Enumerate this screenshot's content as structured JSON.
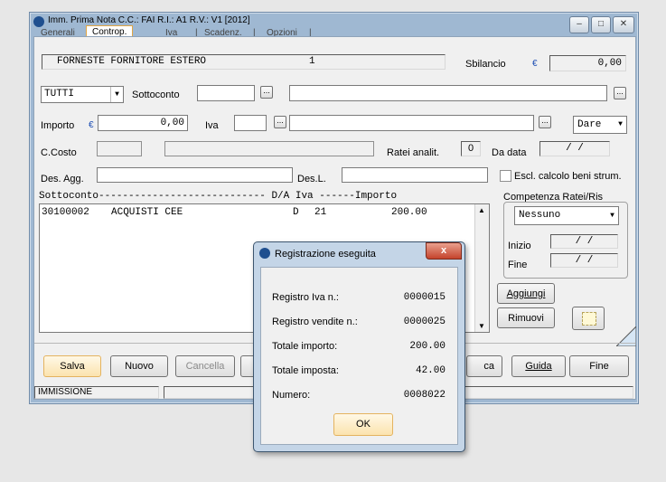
{
  "window": {
    "title": "Imm. Prima Nota C.C.: FAI  R.I.: A1  R.V.: V1  [2012]",
    "tabs": [
      "Generali",
      "Controp.",
      "Iva",
      "Scadenz.",
      "Opzioni"
    ],
    "active_tab": "Controp."
  },
  "header": {
    "supplier": "FORNESTE FORNITORE ESTERO",
    "number": "1",
    "sbilancio_label": "Sbilancio",
    "sbilancio_value": "0,00"
  },
  "form": {
    "filter_select": "TUTTI",
    "sottoconto_label": "Sottoconto",
    "importo_label": "Importo",
    "importo_value": "0,00",
    "iva_label": "Iva",
    "dare_select": "Dare",
    "ccosto_label": "C.Costo",
    "ratei_label": "Ratei analit.",
    "ratei_value": "0",
    "da_data_label": "Da data",
    "da_data_value": "/  /",
    "des_agg_label": "Des. Agg.",
    "des_l_label": "Des.L.",
    "escl_label": "Escl. calcolo beni strum."
  },
  "grid": {
    "header": "Sottoconto---------------------------- D/A  Iva  ------Importo",
    "rows": [
      {
        "code": "30100002",
        "desc": "ACQUISTI CEE",
        "da": "D",
        "iva": "21",
        "importo": "200.00"
      }
    ]
  },
  "competenza": {
    "label": "Competenza Ratei/Ris",
    "select": "Nessuno",
    "inizio_label": "Inizio",
    "inizio_value": "/  /",
    "fine_label": "Fine",
    "fine_value": "/  /"
  },
  "side_buttons": {
    "aggiungi": "Aggiungi",
    "rimuovi": "Rimuovi"
  },
  "bottom_buttons": {
    "salva": "Salva",
    "nuovo": "Nuovo",
    "cancella": "Cancella",
    "stampa_partial": "ca",
    "guida": "Guida",
    "fine": "Fine"
  },
  "status": {
    "mode": "IMMISSIONE"
  },
  "dialog": {
    "title": "Registrazione eseguita",
    "rows": [
      {
        "label": "Registro Iva n.:",
        "value": "0000015"
      },
      {
        "label": "Registro vendite n.:",
        "value": "0000025"
      },
      {
        "label": "Totale importo:",
        "value": "200.00"
      },
      {
        "label": "Totale imposta:",
        "value": "42.00"
      },
      {
        "label": "Numero:",
        "value": "0008022"
      }
    ],
    "ok_label": "OK"
  }
}
